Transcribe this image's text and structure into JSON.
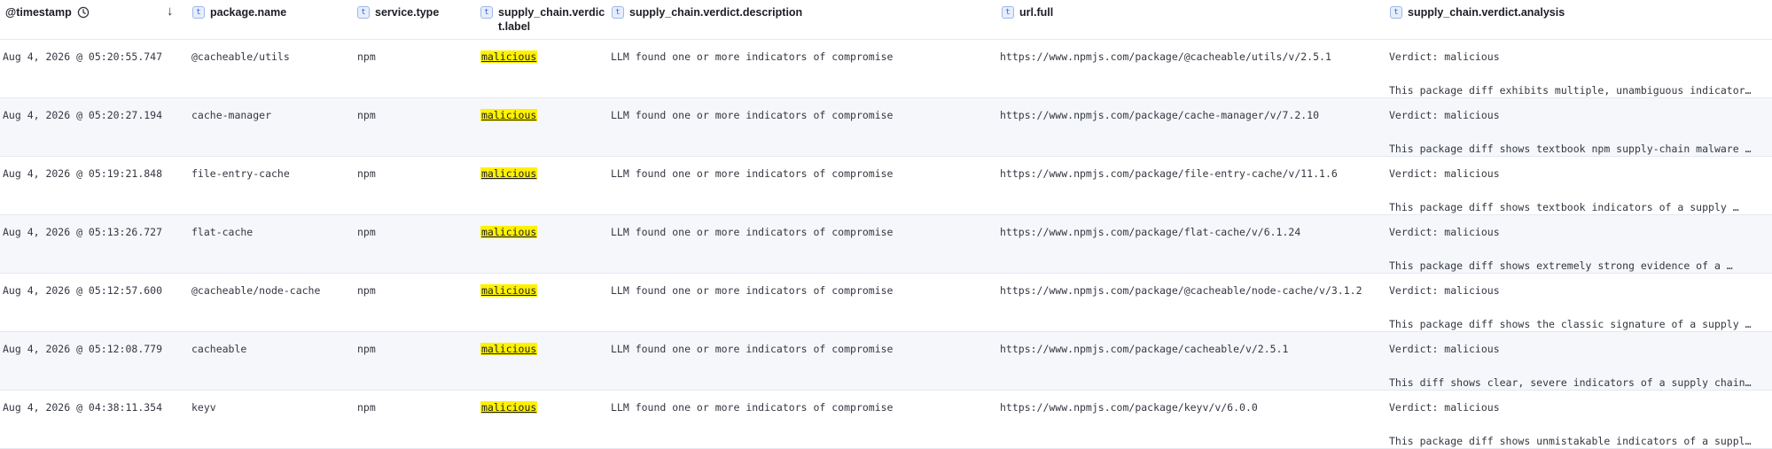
{
  "columns": {
    "timestamp": "@timestamp",
    "package_name": "package.name",
    "service_type": "service.type",
    "verdict_label_line1": "supply_chain.verdic",
    "verdict_label_line2": "t.label",
    "verdict_description": "supply_chain.verdict.description",
    "url_full": "url.full",
    "verdict_analysis": "supply_chain.verdict.analysis",
    "type_badge": "t"
  },
  "icons": {
    "clock": "clock-icon",
    "sort": "sort-descending-arrow-icon",
    "field_type": "text-field-type-icon"
  },
  "colors": {
    "highlight": "#fff200",
    "row_alt": "#f5f7fb",
    "badge_border": "#9fb7e8"
  },
  "sort_arrow": "↓",
  "rows": [
    {
      "timestamp": "Aug 4, 2026 @ 05:20:55.747",
      "package_name": "@cacheable/utils",
      "service_type": "npm",
      "verdict_label": "malicious",
      "description": "LLM found one or more indicators of compromise",
      "url": "https://www.npmjs.com/package/@cacheable/utils/v/2.5.1",
      "analysis_line1": "Verdict: malicious",
      "analysis_line2": "This package diff exhibits multiple, unambiguous indicator…"
    },
    {
      "timestamp": "Aug 4, 2026 @ 05:20:27.194",
      "package_name": "cache-manager",
      "service_type": "npm",
      "verdict_label": "malicious",
      "description": "LLM found one or more indicators of compromise",
      "url": "https://www.npmjs.com/package/cache-manager/v/7.2.10",
      "analysis_line1": "Verdict: malicious",
      "analysis_line2": "This package diff shows textbook npm supply-chain malware …"
    },
    {
      "timestamp": "Aug 4, 2026 @ 05:19:21.848",
      "package_name": "file-entry-cache",
      "service_type": "npm",
      "verdict_label": "malicious",
      "description": "LLM found one or more indicators of compromise",
      "url": "https://www.npmjs.com/package/file-entry-cache/v/11.1.6",
      "analysis_line1": "Verdict: malicious",
      "analysis_line2": "This package diff shows textbook indicators of a supply …"
    },
    {
      "timestamp": "Aug 4, 2026 @ 05:13:26.727",
      "package_name": "flat-cache",
      "service_type": "npm",
      "verdict_label": "malicious",
      "description": "LLM found one or more indicators of compromise",
      "url": "https://www.npmjs.com/package/flat-cache/v/6.1.24",
      "analysis_line1": "Verdict: malicious",
      "analysis_line2": "This package diff shows extremely strong evidence of a …"
    },
    {
      "timestamp": "Aug 4, 2026 @ 05:12:57.600",
      "package_name": "@cacheable/node-cache",
      "service_type": "npm",
      "verdict_label": "malicious",
      "description": "LLM found one or more indicators of compromise",
      "url": "https://www.npmjs.com/package/@cacheable/node-cache/v/3.1.2",
      "analysis_line1": "Verdict: malicious",
      "analysis_line2": "This package diff shows the classic signature of a supply …"
    },
    {
      "timestamp": "Aug 4, 2026 @ 05:12:08.779",
      "package_name": "cacheable",
      "service_type": "npm",
      "verdict_label": "malicious",
      "description": "LLM found one or more indicators of compromise",
      "url": "https://www.npmjs.com/package/cacheable/v/2.5.1",
      "analysis_line1": "Verdict: malicious",
      "analysis_line2": "This diff shows clear, severe indicators of a supply chain…"
    },
    {
      "timestamp": "Aug 4, 2026 @ 04:38:11.354",
      "package_name": "keyv",
      "service_type": "npm",
      "verdict_label": "malicious",
      "description": "LLM found one or more indicators of compromise",
      "url": "https://www.npmjs.com/package/keyv/v/6.0.0",
      "analysis_line1": "Verdict: malicious",
      "analysis_line2": "This package diff shows unmistakable indicators of a suppl…"
    }
  ]
}
